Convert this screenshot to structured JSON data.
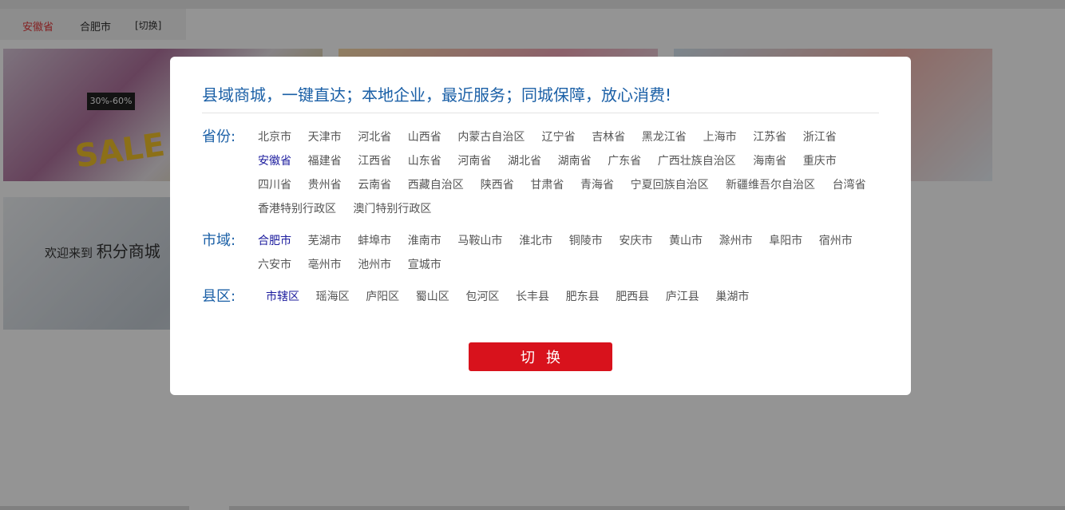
{
  "location_bar": {
    "province": "安徽省",
    "city": "合肥市",
    "switch": "[切换]"
  },
  "banners": {
    "sale_tag": "30%-60%",
    "sale_text": "SALE",
    "welcome_prefix": "欢迎来到",
    "welcome_name": "积分商城"
  },
  "modal": {
    "title": "县域商城，一键直达；本地企业，最近服务；同城保障，放心消费!",
    "province_label": "省份:",
    "city_label": "市域:",
    "county_label": "县区:",
    "provinces": [
      "北京市",
      "天津市",
      "河北省",
      "山西省",
      "内蒙古自治区",
      "辽宁省",
      "吉林省",
      "黑龙江省",
      "上海市",
      "江苏省",
      "浙江省",
      "安徽省",
      "福建省",
      "江西省",
      "山东省",
      "河南省",
      "湖北省",
      "湖南省",
      "广东省",
      "广西壮族自治区",
      "海南省",
      "重庆市",
      "四川省",
      "贵州省",
      "云南省",
      "西藏自治区",
      "陕西省",
      "甘肃省",
      "青海省",
      "宁夏回族自治区",
      "新疆维吾尔自治区",
      "台湾省",
      "香港特别行政区",
      "澳门特别行政区"
    ],
    "selected_province": "安徽省",
    "cities": [
      "合肥市",
      "芜湖市",
      "蚌埠市",
      "淮南市",
      "马鞍山市",
      "淮北市",
      "铜陵市",
      "安庆市",
      "黄山市",
      "滁州市",
      "阜阳市",
      "宿州市",
      "六安市",
      "亳州市",
      "池州市",
      "宣城市"
    ],
    "selected_city": "合肥市",
    "counties": [
      "市辖区",
      "瑶海区",
      "庐阳区",
      "蜀山区",
      "包河区",
      "长丰县",
      "肥东县",
      "肥西县",
      "庐江县",
      "巢湖市"
    ],
    "selected_county": "市辖区",
    "switch_button": "切换"
  },
  "colors": {
    "accent_blue": "#1a5fa6",
    "selected": "#1c1c9e",
    "button_red": "#d8121c",
    "location_red": "#e4393c"
  }
}
